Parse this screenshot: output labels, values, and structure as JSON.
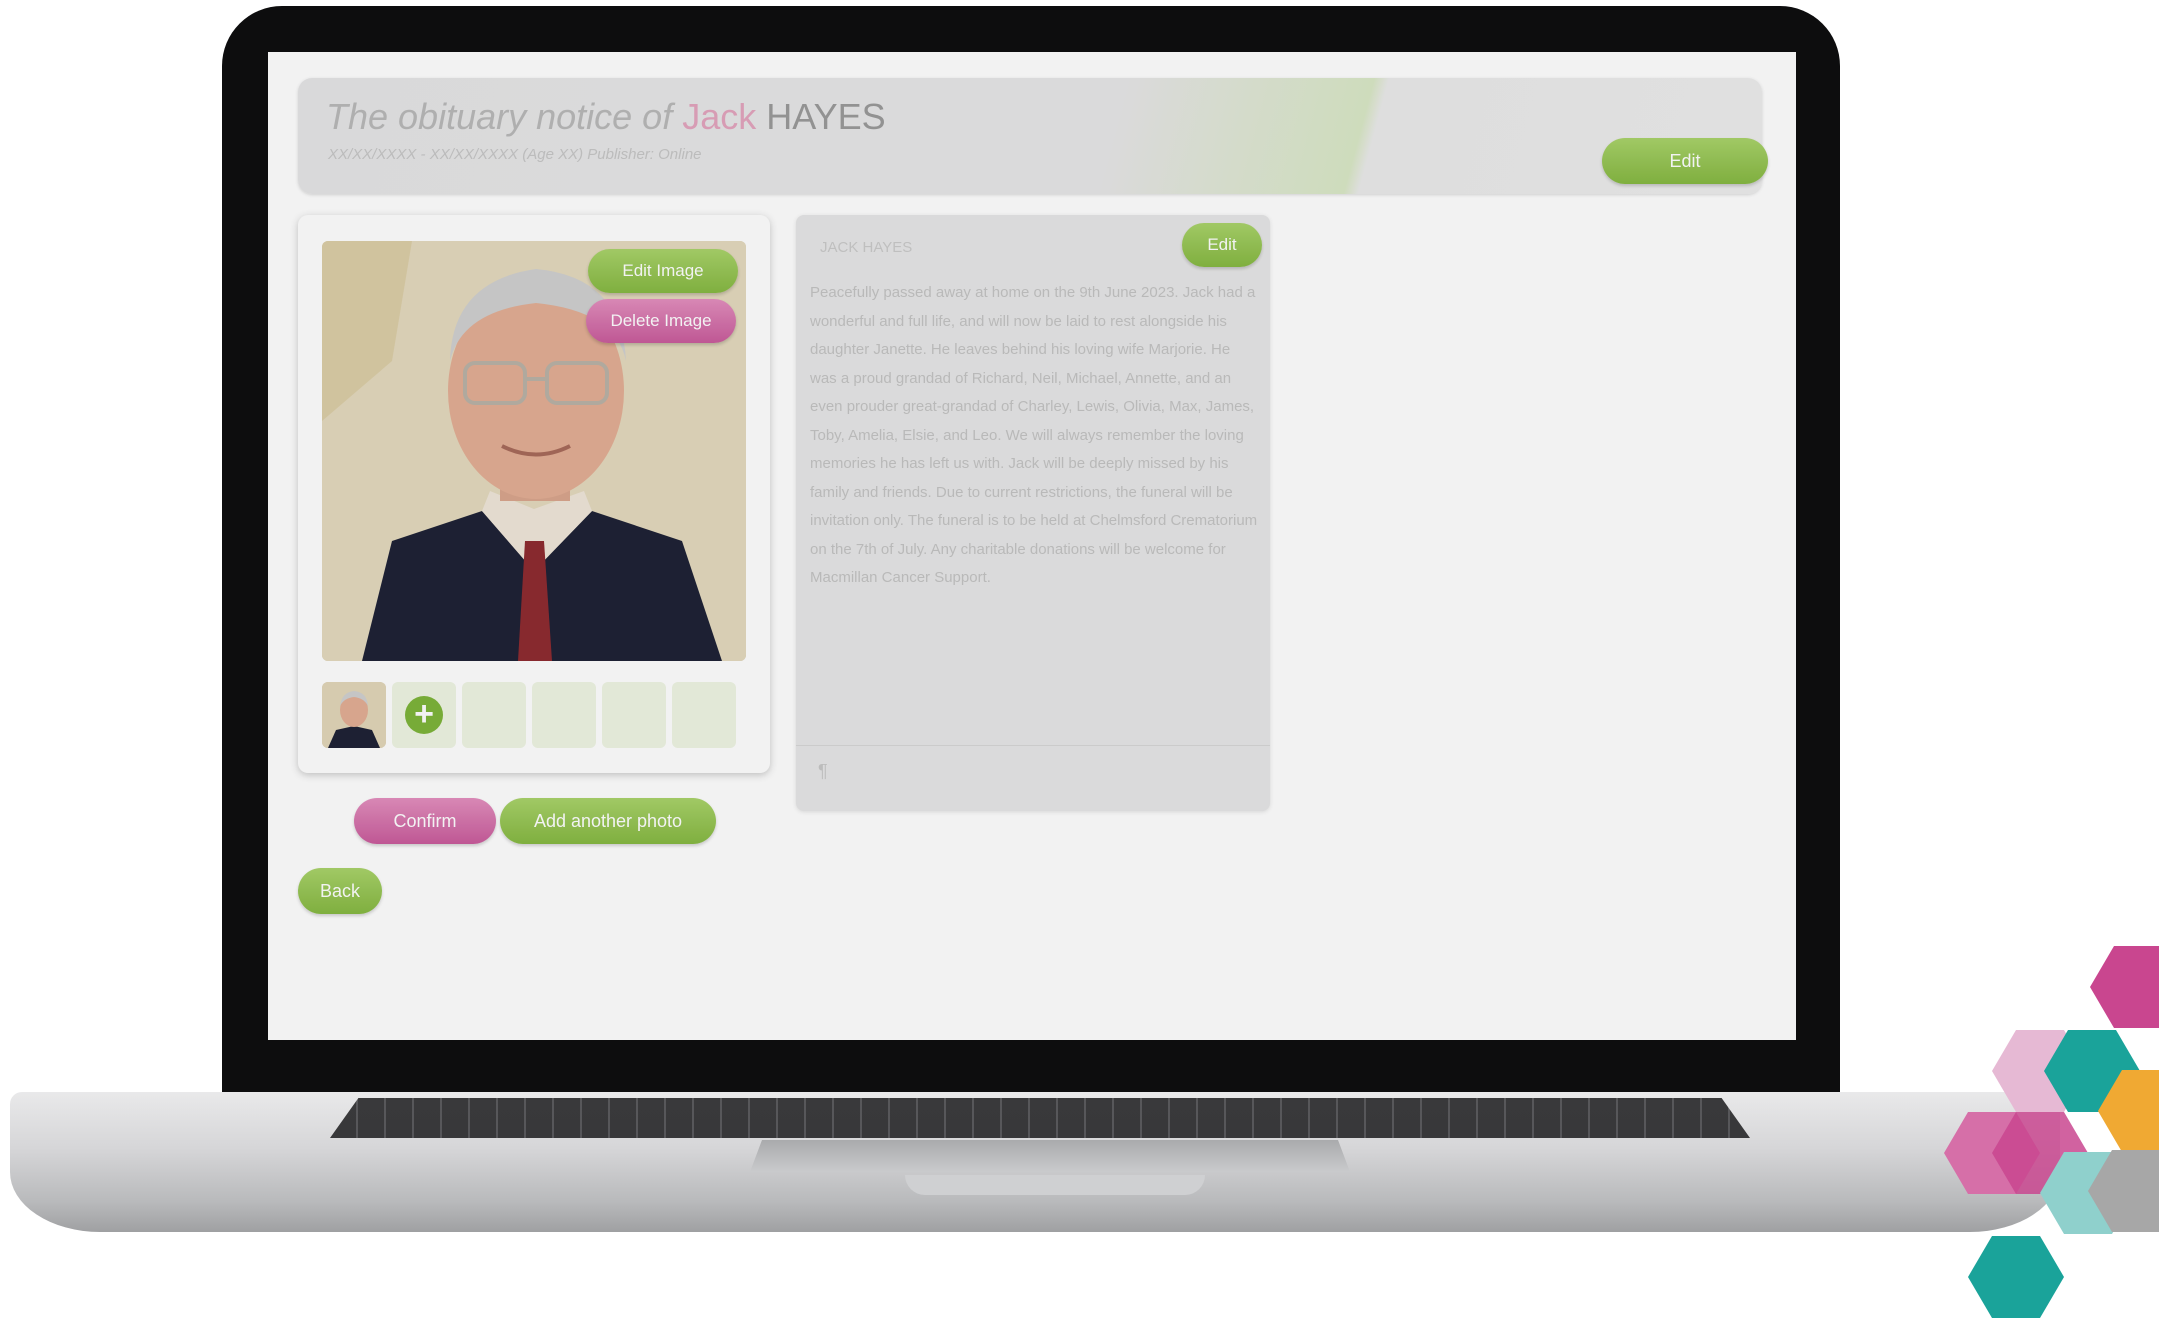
{
  "header": {
    "title_prefix": "The obituary notice of",
    "first_name": "Jack",
    "last_name": "HAYES",
    "subtitle": "XX/XX/XXXX - XX/XX/XXXX (Age XX) Publisher: Online",
    "edit_label": "Edit"
  },
  "photo": {
    "edit_image_label": "Edit Image",
    "delete_image_label": "Delete Image",
    "add_icon": "+"
  },
  "actions": {
    "confirm_label": "Confirm",
    "add_photo_label": "Add another photo",
    "back_label": "Back"
  },
  "notice": {
    "name": "JACK HAYES",
    "edit_label": "Edit",
    "body": "Peacefully passed away at home on the 9th June 2023. Jack had a wonderful and full life, and will now be laid to rest alongside his daughter Janette. He leaves behind his loving wife Marjorie. He was a proud grandad of Richard, Neil, Michael, Annette, and an even prouder great-grandad of Charley, Lewis, Olivia, Max, James, Toby, Amelia, Elsie, and Leo. We will always remember the loving memories he has left us with. Jack will be deeply missed by his family and friends. Due to current restrictions, the funeral will be invitation only. The funeral is to be held at Chelmsford Crematorium on the 7th of July. Any charitable donations will be welcome for Macmillan Cancer Support.",
    "footer_icon": "¶"
  },
  "colors": {
    "green": "#8cbf45",
    "pink": "#d46aa8",
    "teal": "#1aa39a",
    "orange": "#f0a933"
  }
}
